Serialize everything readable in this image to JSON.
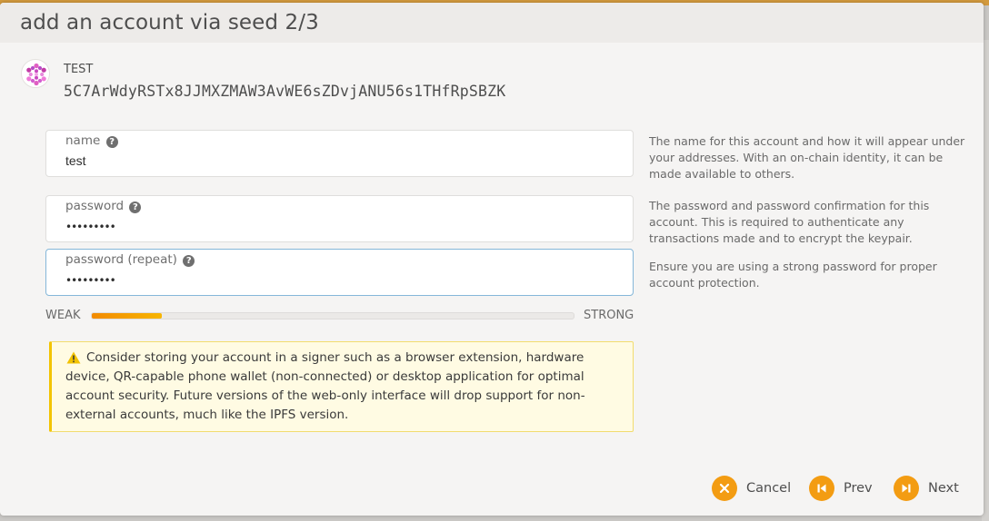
{
  "modal": {
    "title": "add an account via seed 2/3"
  },
  "account": {
    "name": "TEST",
    "address": "5C7ArWdyRSTx8JJMXZMAW3AvWE6sZDvjANU56s1THfRpSBZK",
    "icon": "identicon"
  },
  "fields": {
    "name": {
      "label": "name",
      "value": "test",
      "help": "The name for this account and how it will appear under your addresses. With an on-chain identity, it can be made available to others."
    },
    "password": {
      "label": "password",
      "value": "•••••••••",
      "help": "The password and password confirmation for this account. This is required to authenticate any transactions made and to encrypt the keypair."
    },
    "password_repeat": {
      "label": "password (repeat)",
      "value": "•••••••••",
      "help": "Ensure you are using a strong password for proper account protection."
    }
  },
  "strength": {
    "weak_label": "WEAK",
    "strong_label": "STRONG",
    "level": 0.145,
    "colors": [
      "#f28a00",
      "#f7b500"
    ]
  },
  "warning": {
    "icon": "warning-triangle-icon",
    "text": "Consider storing your account in a signer such as a browser extension, hardware device, QR-capable phone wallet (non-connected) or desktop application for optimal account security. Future versions of the web-only interface will drop support for non-external accounts, much like the IPFS version."
  },
  "actions": {
    "cancel": "Cancel",
    "prev": "Prev",
    "next": "Next"
  },
  "colors": {
    "accent": "#f39c12",
    "header_accent": "#d39a3e",
    "focus_border": "#85b7d9"
  }
}
